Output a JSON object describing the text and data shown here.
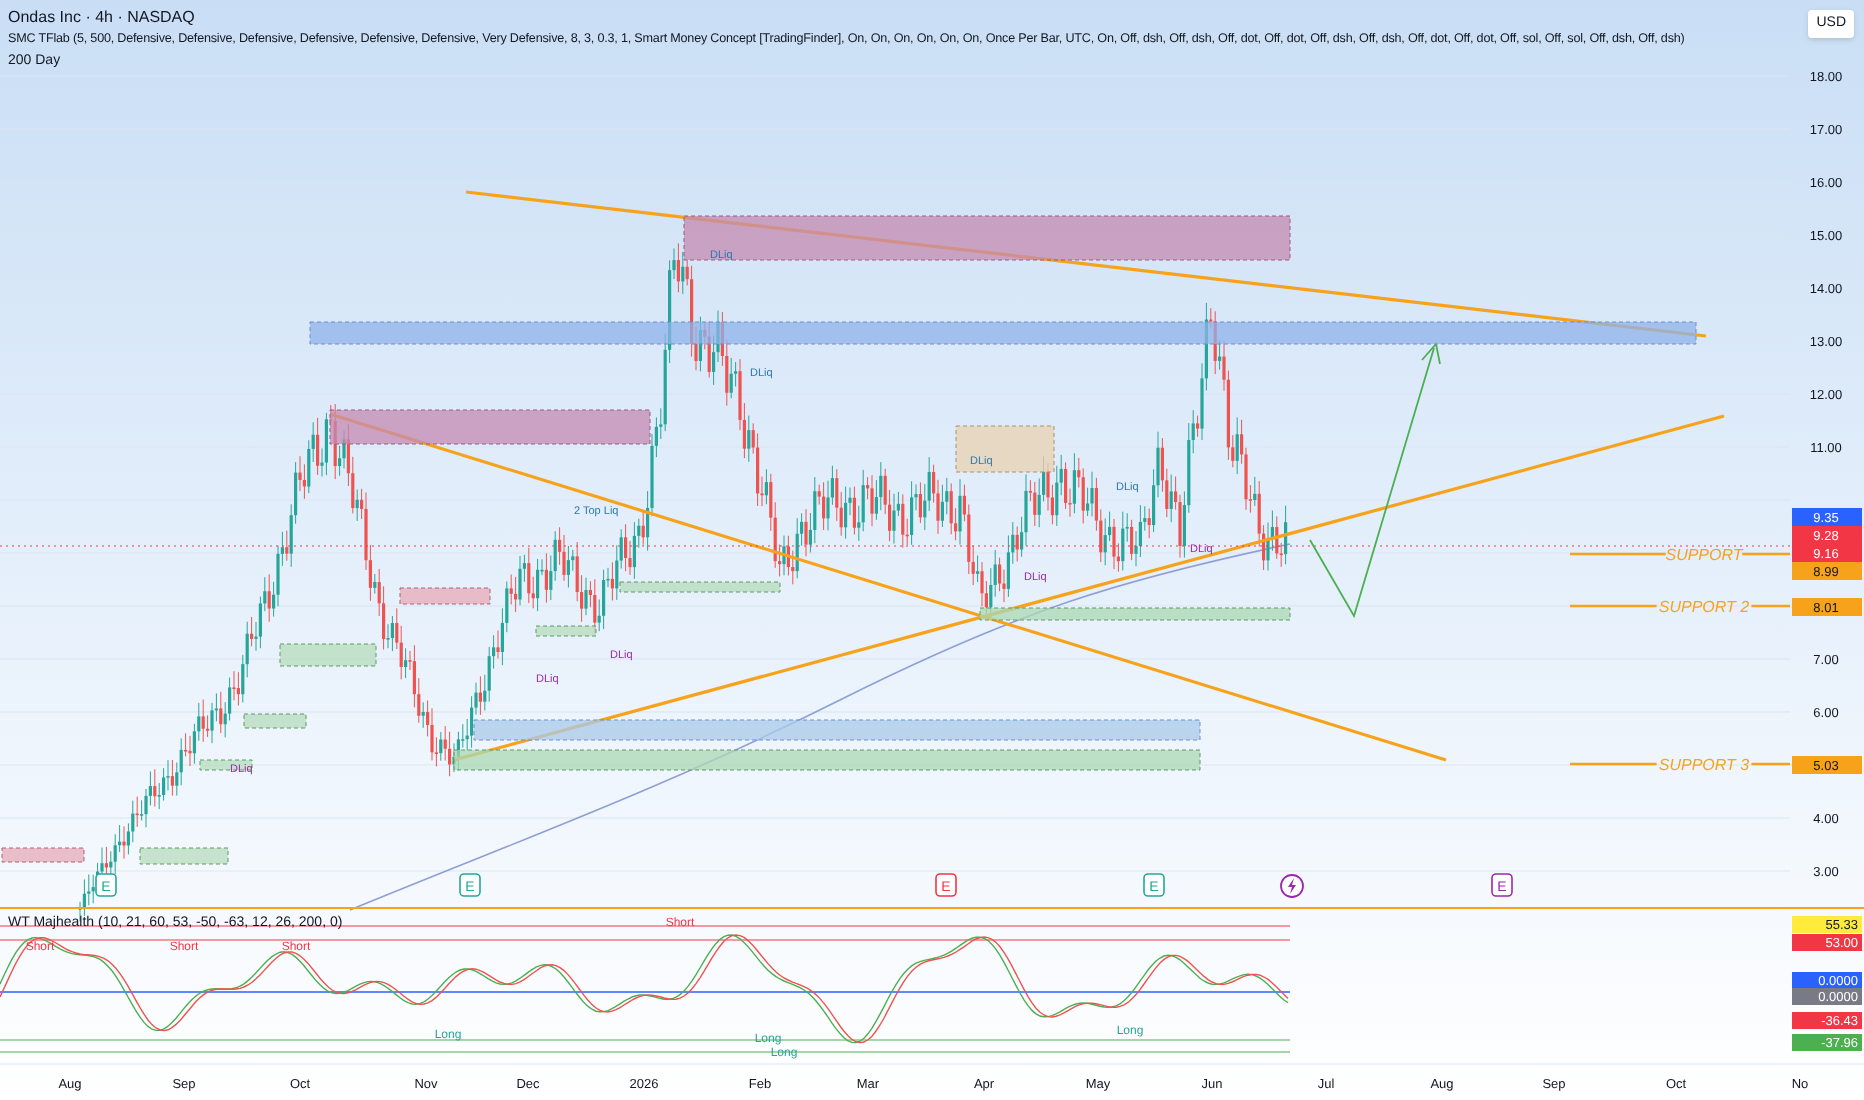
{
  "header": {
    "title": "Ondas Inc · 4h · NASDAQ",
    "indicators": [
      "SMC TFlab (5, 500, Defensive, Defensive, Defensive, Defensive, Defensive, Defensive, Very Defensive, 8, 3, 0.3, 1, Smart Money Concept [TradingFinder], On, On, On, On, On, On, Once Per Bar, UTC, On, Off, dsh, Off, dsh, Off, dot, Off, dot, Off, dsh, Off, dsh, Off, dot, Off, dot, Off, sol, Off, sol, Off, dsh, Off, dsh)",
      "200 Day"
    ]
  },
  "currency_button": "USD",
  "price_axis": [
    "18.00",
    "17.00",
    "16.00",
    "15.00",
    "14.00",
    "13.00",
    "12.00",
    "11.00",
    "7.00",
    "6.00",
    "4.00",
    "3.00"
  ],
  "price_tags": [
    {
      "text": "9.35",
      "color": "#2962ff"
    },
    {
      "text": "9.28",
      "color": "#f23645"
    },
    {
      "text": "9.16",
      "color": "#f23645"
    },
    {
      "text": "8.99",
      "color": "#f7a21b"
    },
    {
      "text": "8.01",
      "color": "#f7a21b"
    },
    {
      "text": "5.03",
      "color": "#f7a21b"
    }
  ],
  "support_lines": [
    "SUPPORT",
    "SUPPORT 2",
    "SUPPORT 3"
  ],
  "chart_labels": [
    "DLiq",
    "DLiq",
    "2 Top Liq",
    "DLiq",
    "DLiq",
    "DLiq",
    "DLiq",
    "DLiq",
    "DLiq",
    "DLiq"
  ],
  "events": [
    {
      "kind": "earnings",
      "label": "E",
      "color": "#26a69a"
    },
    {
      "kind": "earnings",
      "label": "E",
      "color": "#26a69a"
    },
    {
      "kind": "earnings",
      "label": "E",
      "color": "#f23645"
    },
    {
      "kind": "earnings",
      "label": "E",
      "color": "#26a69a"
    },
    {
      "kind": "bolt",
      "color": "#9c27b0"
    },
    {
      "kind": "earnings",
      "label": "E",
      "color": "#9c27b0"
    }
  ],
  "oscillator": {
    "title": "WT Majhealth (10, 21, 60, 53, -50, -63, 12, 26, 200, 0)",
    "signals": [
      {
        "kind": "short",
        "label": "Short"
      },
      {
        "kind": "short",
        "label": "Short"
      },
      {
        "kind": "short",
        "label": "Short"
      },
      {
        "kind": "short",
        "label": "Short"
      },
      {
        "kind": "long",
        "label": "Long"
      },
      {
        "kind": "long",
        "label": "Long"
      },
      {
        "kind": "long",
        "label": "Long"
      },
      {
        "kind": "long",
        "label": "Long"
      }
    ],
    "tags": [
      {
        "text": "55.33",
        "color": "#ffeb3b"
      },
      {
        "text": "53.00",
        "color": "#f23645"
      },
      {
        "text": "0.0000",
        "color": "#2962ff"
      },
      {
        "text": "0.0000",
        "color": "#787b86"
      },
      {
        "text": "-36.43",
        "color": "#f23645"
      },
      {
        "text": "-37.96",
        "color": "#4caf50"
      }
    ]
  },
  "time_axis": [
    "Aug",
    "Sep",
    "Oct",
    "Nov",
    "Dec",
    "2026",
    "Feb",
    "Mar",
    "Apr",
    "May",
    "Jun",
    "Jul",
    "Aug",
    "Sep",
    "Oct",
    "No"
  ]
}
